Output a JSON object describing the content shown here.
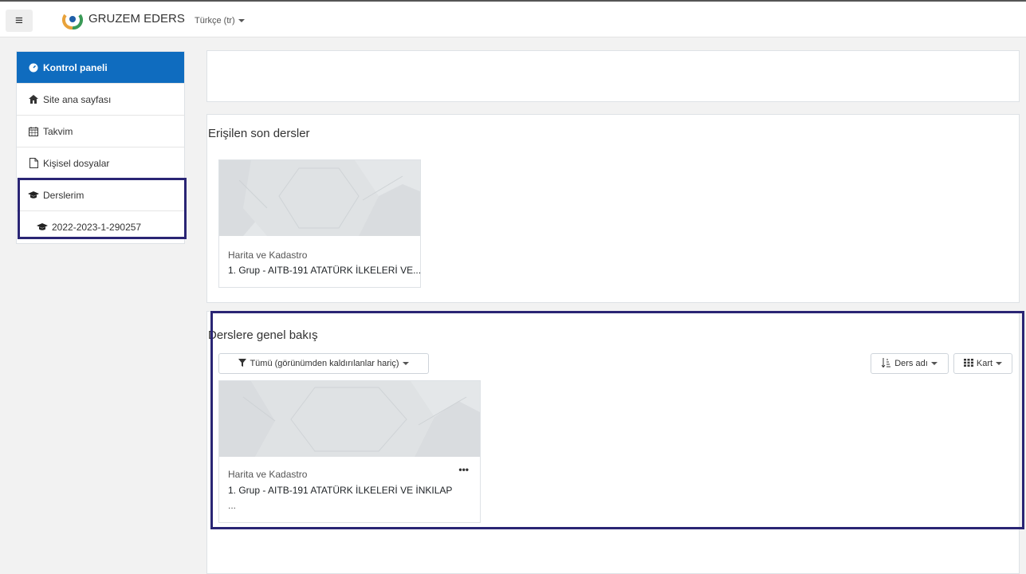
{
  "header": {
    "brand": "GRUZEM EDERS",
    "language": "Türkçe ‎(tr)‎"
  },
  "sidebar": {
    "items": [
      {
        "label": "Kontrol paneli",
        "icon": "dashboard-icon",
        "active": true
      },
      {
        "label": "Site ana sayfası",
        "icon": "home-icon"
      },
      {
        "label": "Takvim",
        "icon": "calendar-icon"
      },
      {
        "label": "Kişisel dosyalar",
        "icon": "file-icon"
      },
      {
        "label": "Derslerim",
        "icon": "graduation-cap-icon"
      },
      {
        "label": "2022-2023-1-290257",
        "icon": "graduation-cap-icon"
      }
    ]
  },
  "recent": {
    "title": "Erişilen son dersler",
    "course": {
      "category": "Harita ve Kadastro",
      "name": "1. Grup - AITB-191 ATATÜRK İLKELERİ VE..."
    }
  },
  "overview": {
    "title": "Derslere genel bakış",
    "filter_label": "Tümü (görünümden kaldırılanlar hariç)",
    "sort_label": "Ders adı",
    "view_label": "Kart",
    "course": {
      "category": "Harita ve Kadastro",
      "name": "1. Grup - AITB-191 ATATÜRK İLKELERİ VE İNKILAP",
      "name_more": "...",
      "menu": "•••"
    }
  },
  "colors": {
    "accent": "#0f6cbf",
    "highlight": "#2a2574"
  }
}
